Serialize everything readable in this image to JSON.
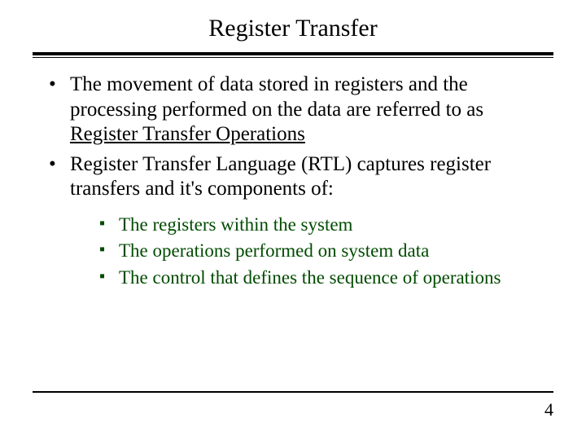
{
  "title": "Register Transfer",
  "bullets": {
    "b1_pre": "The movement of data stored in registers and the processing performed on the data are referred to as ",
    "b1_u": "Register Transfer Operations",
    "b2": "Register Transfer Language (RTL) captures register transfers and it's components of:"
  },
  "sub": {
    "s1": "The registers within the system",
    "s2": "The operations performed on system data",
    "s3": "The control that defines the sequence of operations"
  },
  "page": "4"
}
